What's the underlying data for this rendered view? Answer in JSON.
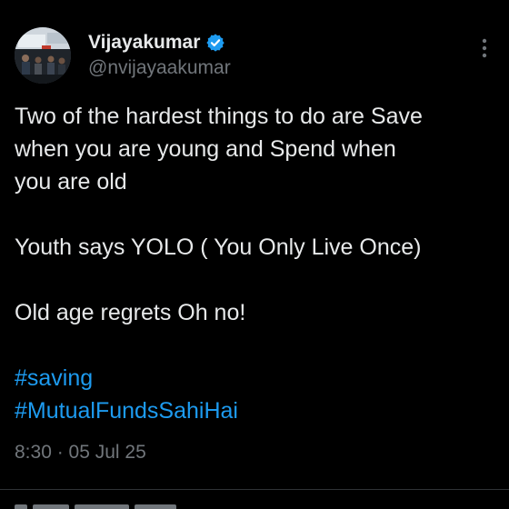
{
  "author": {
    "display_name": "Vijayakumar",
    "handle": "@nvijayaakumar",
    "verified_icon": "verified-badge-icon",
    "verified_color": "#1d9bf0"
  },
  "tweet": {
    "lines": [
      "Two of the hardest things to do are Save",
      "when you are young and Spend when",
      "you are old",
      "Youth says YOLO ( You Only Live Once)",
      "Old age regrets Oh no!"
    ],
    "hashtags": [
      "#saving",
      "#MutualFundsSahiHai"
    ],
    "timestamp": "8:30 · 05 Jul 25"
  },
  "menu": {
    "icon": "more-vertical-icon"
  },
  "colors": {
    "background": "#000000",
    "text": "#e7e9ea",
    "secondary": "#71767b",
    "link": "#1d9bf0",
    "divider": "#2f3336"
  }
}
